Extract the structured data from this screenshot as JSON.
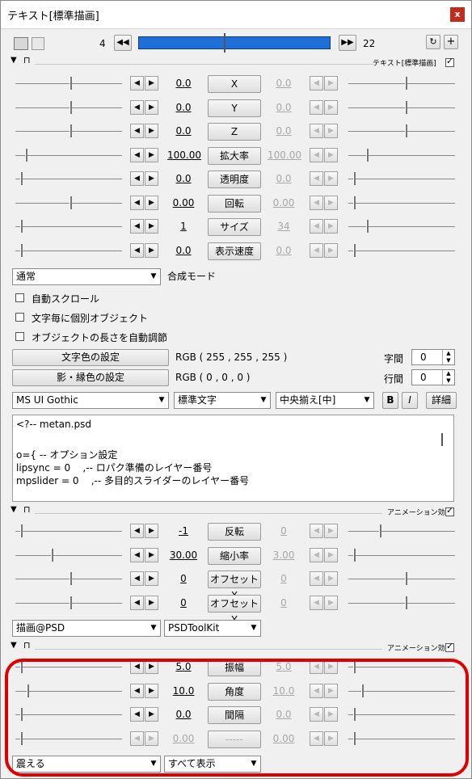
{
  "window": {
    "title": "テキスト[標準描画]",
    "close_label": "x"
  },
  "timeline": {
    "start": "4",
    "end": "22",
    "prev_label": "◀◀",
    "next_label": "▶▶"
  },
  "section1": {
    "title": "テキスト[標準描画]",
    "checked": true
  },
  "params1": [
    {
      "left": "0.0",
      "name": "X",
      "right": "0.0",
      "right_disabled": true
    },
    {
      "left": "0.0",
      "name": "Y",
      "right": "0.0",
      "right_disabled": true
    },
    {
      "left": "0.0",
      "name": "Z",
      "right": "0.0",
      "right_disabled": true
    },
    {
      "left": "100.00",
      "name": "拡大率",
      "right": "100.00",
      "right_disabled": true
    },
    {
      "left": "0.0",
      "name": "透明度",
      "right": "0.0",
      "right_disabled": true
    },
    {
      "left": "0.00",
      "name": "回転",
      "right": "0.00",
      "right_disabled": true
    },
    {
      "left": "1",
      "name": "サイズ",
      "right": "34",
      "right_disabled": true
    },
    {
      "left": "0.0",
      "name": "表示速度",
      "right": "0.0",
      "right_disabled": true
    }
  ],
  "blend": {
    "value": "通常",
    "label": "合成モード"
  },
  "checkboxes": [
    {
      "label": "自動スクロール",
      "checked": false
    },
    {
      "label": "文字毎に個別オブジェクト",
      "checked": false
    },
    {
      "label": "オブジェクトの長さを自動調節",
      "checked": false
    }
  ],
  "text_color": {
    "button": "文字色の設定",
    "value": "RGB ( 255 , 255 , 255 )"
  },
  "shadow_color": {
    "button": "影・縁色の設定",
    "value": "RGB ( 0 , 0 , 0 )"
  },
  "spacing": {
    "char_label": "字間",
    "char_value": "0",
    "line_label": "行間",
    "line_value": "0"
  },
  "font": {
    "family": "MS UI Gothic",
    "style": "標準文字",
    "align": "中央揃え[中]",
    "bold": "B",
    "italic": "I",
    "detail": "詳細"
  },
  "text_lines": [
    "<?-- metan.psd",
    "",
    "o={ -- オプション設定",
    "lipsync = 0    ,-- ロパク準備のレイヤー番号",
    "mpslider = 0    ,-- 多目的スライダーのレイヤー番号"
  ],
  "section2": {
    "title": "アニメーション効果",
    "checked": true
  },
  "params2": [
    {
      "left": "-1",
      "name": "反転",
      "right": "0",
      "right_disabled": true
    },
    {
      "left": "30.00",
      "name": "縮小率",
      "right": "3.00",
      "right_disabled": true
    },
    {
      "left": "0",
      "name": "オフセットX",
      "right": "0",
      "right_disabled": true
    },
    {
      "left": "0",
      "name": "オフセットY",
      "right": "0",
      "right_disabled": true
    }
  ],
  "section2_dd": {
    "a": "描画@PSD",
    "b": "PSDToolKit"
  },
  "section3": {
    "title": "アニメーション効果",
    "checked": true
  },
  "params3": [
    {
      "left": "5.0",
      "name": "振幅",
      "right": "5.0",
      "right_disabled": true
    },
    {
      "left": "10.0",
      "name": "角度",
      "right": "10.0",
      "right_disabled": true
    },
    {
      "left": "0.0",
      "name": "間隔",
      "right": "0.0",
      "right_disabled": true
    },
    {
      "left": "0.00",
      "name": "-----",
      "right": "0.00",
      "right_disabled": true,
      "disabled": true
    }
  ],
  "section3_dd": {
    "a": "震える",
    "b": "すべて表示"
  },
  "colors": {
    "accent": "#1e6fd9",
    "highlight": "#e00000"
  }
}
